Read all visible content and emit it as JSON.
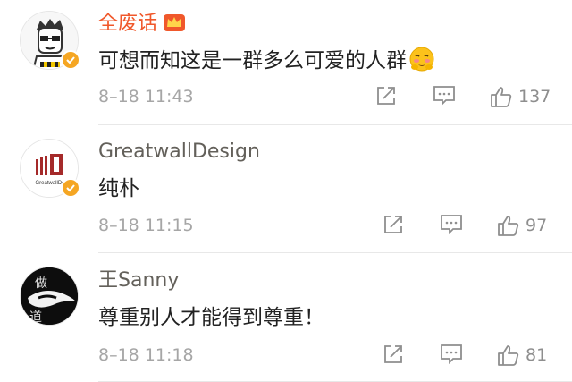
{
  "comments": [
    {
      "username": "全废话",
      "text": "可想而知这是一群多么可爱的人群",
      "time": "8–18 11:43",
      "likes": "137",
      "avatar_icon": "cartoon-man-avatar",
      "has_crown": true,
      "has_emoji": true
    },
    {
      "username": "GreatwallDesign",
      "text": "纯朴",
      "time": "8–18 11:15",
      "likes": "97",
      "avatar_icon": "greatwall-design-logo",
      "avatar_logo_text": "GreatwallDe"
    },
    {
      "username": "王Sanny",
      "text": "尊重别人才能得到尊重！",
      "time": "8–18 11:18",
      "likes": "81",
      "avatar_icon": "calligraphy-avatar",
      "avatar_text_top": "做",
      "avatar_text_bottom": "道"
    }
  ],
  "colors": {
    "vip_name": "#f0582b",
    "name": "#63605a",
    "text": "#222222",
    "meta": "#a6a6a6",
    "verified_badge": "#f5a623"
  }
}
